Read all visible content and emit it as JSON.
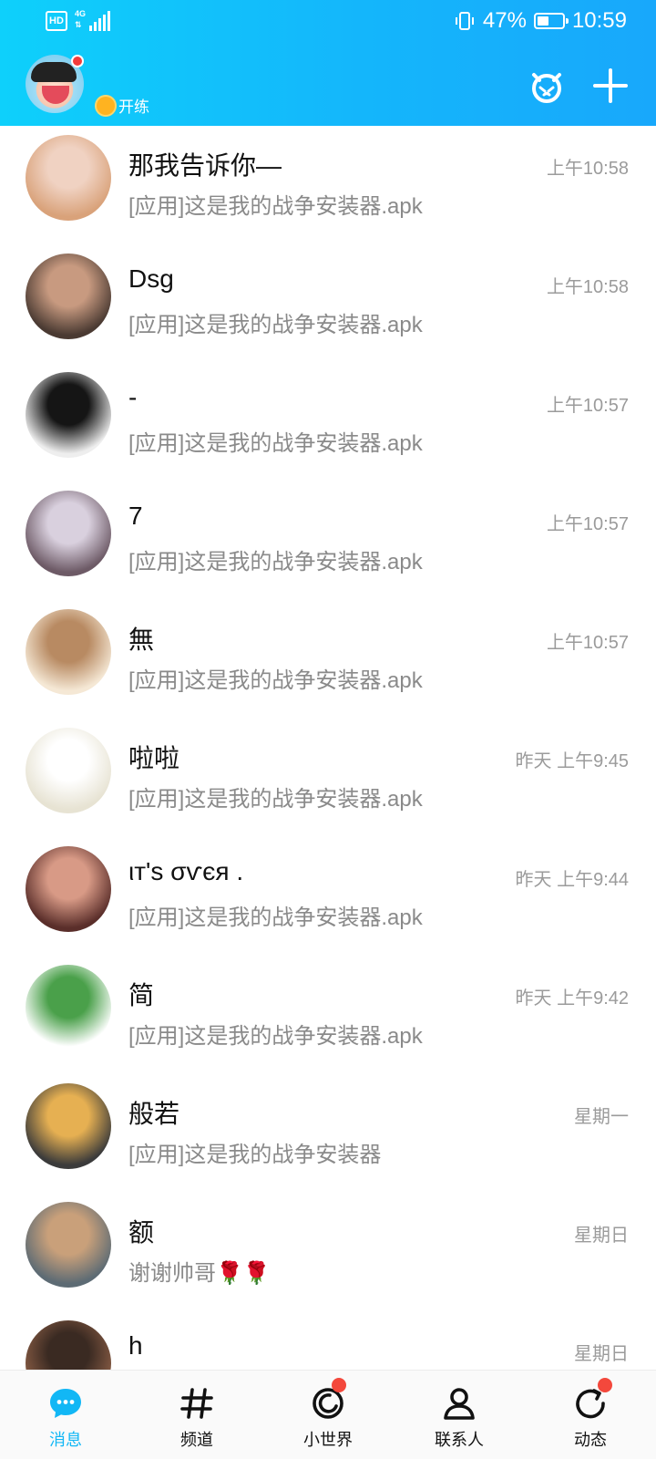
{
  "status_bar": {
    "hd": "HD",
    "network": "4G",
    "battery": "47%",
    "battery_level": 0.47,
    "time": "10:59"
  },
  "header": {
    "level_label": "开练"
  },
  "chats": [
    {
      "name": "那我告诉你—",
      "message": "[应用]这是我的战争安装器.apk",
      "time": "上午10:58",
      "avatar": "cat-photo",
      "color1": "#d9a27a",
      "color2": "#f0d2c2"
    },
    {
      "name": "Dsg",
      "message": "[应用]这是我的战争安装器.apk",
      "time": "上午10:58",
      "avatar": "boy-photo",
      "color1": "#4a3a32",
      "color2": "#c89a80"
    },
    {
      "name": "-",
      "message": "[应用]这是我的战争安装器.apk",
      "time": "上午10:57",
      "avatar": "dark-figure",
      "color1": "#eeeeee",
      "color2": "#151515"
    },
    {
      "name": "7",
      "message": "[应用]这是我的战争安装器.apk",
      "time": "上午10:57",
      "avatar": "anime-boy",
      "color1": "#6d5a66",
      "color2": "#d9d0de"
    },
    {
      "name": "無",
      "message": "[应用]这是我的战争安装器.apk",
      "time": "上午10:57",
      "avatar": "bear-cartoon",
      "color1": "#f5e8d5",
      "color2": "#b88a62"
    },
    {
      "name": "啦啦",
      "message": "[应用]这是我的战争安装器.apk",
      "time": "昨天 上午9:45",
      "avatar": "small-doll",
      "color1": "#e7e3d3",
      "color2": "#ffffff"
    },
    {
      "name": "ιт'ѕ σѵєя .",
      "message": "[应用]这是我的战争安装器.apk",
      "time": "昨天 上午9:44",
      "avatar": "girl-painting",
      "color1": "#5a2e2a",
      "color2": "#d89a86"
    },
    {
      "name": "简",
      "message": "[应用]这是我的战争安装器.apk",
      "time": "昨天 上午9:42",
      "avatar": "green-cap-boy",
      "color1": "#ffffff",
      "color2": "#4aa04a"
    },
    {
      "name": "般若",
      "message": "[应用]这是我的战争安装器",
      "time": "星期一",
      "avatar": "moon-photo",
      "color1": "#3b3b3b",
      "color2": "#e6b052"
    },
    {
      "name": "额",
      "message": "谢谢帅哥🌹🌹",
      "time": "星期日",
      "avatar": "street-girl",
      "color1": "#5d6b74",
      "color2": "#c9a07a"
    },
    {
      "name": "h",
      "message": "",
      "time": "星期日",
      "avatar": "man-portrait",
      "color1": "#8a5d45",
      "color2": "#3a2a22"
    }
  ],
  "bottom_nav": [
    {
      "label": "消息",
      "icon": "message-icon",
      "active": true,
      "dot": false
    },
    {
      "label": "频道",
      "icon": "hash-icon",
      "active": false,
      "dot": false
    },
    {
      "label": "小世界",
      "icon": "world-icon",
      "active": false,
      "dot": true
    },
    {
      "label": "联系人",
      "icon": "contacts-icon",
      "active": false,
      "dot": false
    },
    {
      "label": "动态",
      "icon": "feed-icon",
      "active": false,
      "dot": true
    }
  ],
  "colors": {
    "accent": "#12b7f5",
    "badge_red": "#f3483c"
  }
}
